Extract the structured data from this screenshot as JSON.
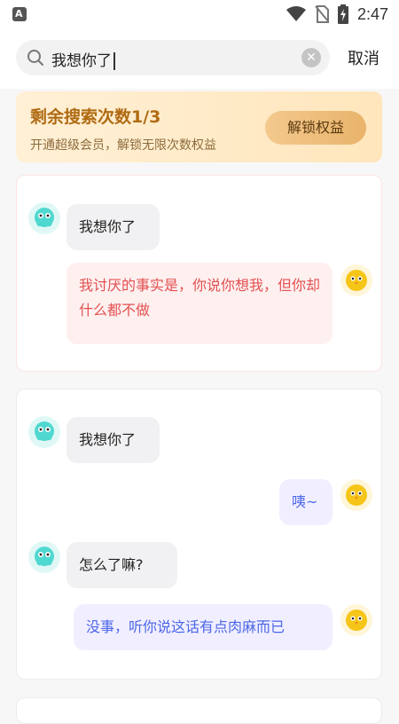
{
  "status_bar": {
    "time": "2:47",
    "app_badge": "A"
  },
  "search": {
    "query": "我想你了",
    "clear_icon": "clear-icon",
    "cancel_label": "取消"
  },
  "vip": {
    "title": "剩余搜索次数1/3",
    "subtitle": "开通超级会员，解锁无限次数权益",
    "button_label": "解锁权益"
  },
  "results": [
    {
      "messages": [
        {
          "side": "left",
          "text": "我想你了"
        },
        {
          "side": "right",
          "text": "我讨厌的事实是，你说你想我，但你却什么都不做"
        }
      ]
    },
    {
      "messages": [
        {
          "side": "left",
          "text": "我想你了"
        },
        {
          "side": "right",
          "text": "咦~"
        },
        {
          "side": "left",
          "text": "怎么了嘛?"
        },
        {
          "side": "right",
          "text": "没事，听你说这话有点肉麻而已"
        }
      ]
    }
  ],
  "colors": {
    "vip_title": "#b06b12",
    "red_bubble_text": "#e35050",
    "blue_bubble_text": "#4b66e8",
    "left_avatar": "#4fd8d0",
    "right_avatar": "#f5c518"
  }
}
